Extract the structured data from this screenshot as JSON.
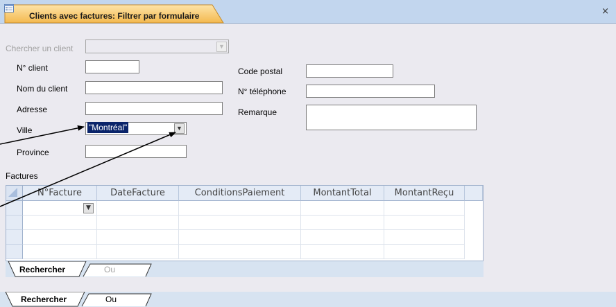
{
  "title_tab": {
    "label": "Clients avec factures: Filtrer par formulaire",
    "close_glyph": "×"
  },
  "form": {
    "search_client": {
      "label": "Chercher un client",
      "value": ""
    },
    "fields": {
      "client_no": {
        "label": "N° client",
        "value": ""
      },
      "client_name": {
        "label": "Nom du client",
        "value": ""
      },
      "address": {
        "label": "Adresse",
        "value": ""
      },
      "city": {
        "label": "Ville",
        "value": "\"Montréal\""
      },
      "province": {
        "label": "Province",
        "value": ""
      },
      "postal_code": {
        "label": "Code postal",
        "value": ""
      },
      "phone": {
        "label": "N° téléphone",
        "value": ""
      },
      "remark": {
        "label": "Remarque",
        "value": ""
      }
    },
    "invoices": {
      "label": "Factures",
      "columns": [
        "N°Facture",
        "DateFacture",
        "ConditionsPaiement",
        "MontantTotal",
        "MontantReçu"
      ]
    },
    "subform_tabs": {
      "find": "Rechercher",
      "or": "Ou"
    },
    "bottom_tabs": {
      "find": "Rechercher",
      "or": "Ou"
    }
  },
  "icons": {
    "form_icon": "form-icon",
    "dropdown_arrow": "chevron-down-icon",
    "annotation_arrows": "arrow-icon"
  },
  "colors": {
    "tab_bar": "#c2d6ee",
    "active_tab": "#f6c368",
    "form_background": "#ebeaf0",
    "selection": "#0a246a",
    "grid_header": "#e4ebf6",
    "strip": "#d7e3f1"
  }
}
